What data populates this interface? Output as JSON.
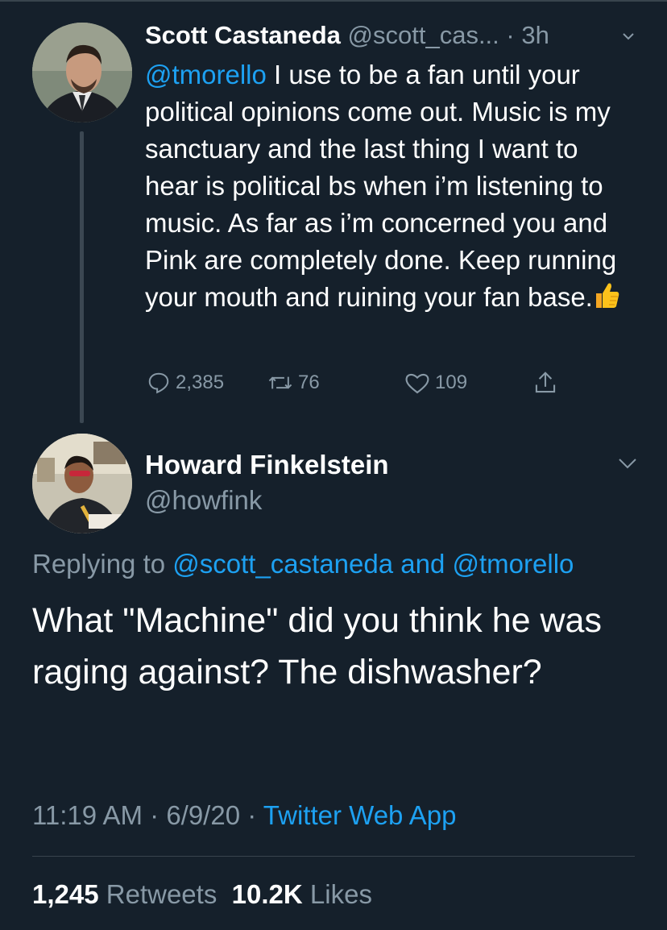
{
  "parent_tweet": {
    "author_name": "Scott Castaneda",
    "author_handle": "@scott_cas...",
    "separator": " · ",
    "age": "3h",
    "mention": "@tmorello",
    "body": " I use to be a fan until your political opinions come out. Music is my sanctuary and the last thing I want to hear is political bs when i’m listening to music. As far as i’m concerned you and Pink are completely done. Keep running your mouth and ruining your fan base.",
    "reply_count": "2,385",
    "retweet_count": "76",
    "like_count": "109",
    "icons": [
      "reply-icon",
      "retweet-icon",
      "like-icon",
      "share-icon",
      "thumbs-up-emoji"
    ]
  },
  "reply_tweet": {
    "author_name": "Howard Finkelstein",
    "author_handle": "@howfink",
    "replying_prefix": "Replying to ",
    "replying_user1": "@scott_castaneda",
    "replying_and": " and ",
    "replying_user2": "@tmorello",
    "text": "What \"Machine\" did you think he was raging against? The dishwasher?",
    "time": "11:19 AM",
    "sep1": " · ",
    "date": "6/9/20",
    "sep2": " · ",
    "source": "Twitter Web App",
    "retweets_value": "1,245",
    "retweets_label": "Retweets",
    "likes_value": "10.2K",
    "likes_label": "Likes"
  },
  "colors": {
    "background": "#15202b",
    "link": "#1da1f2",
    "muted": "#8899a6",
    "divider": "#38444d"
  }
}
